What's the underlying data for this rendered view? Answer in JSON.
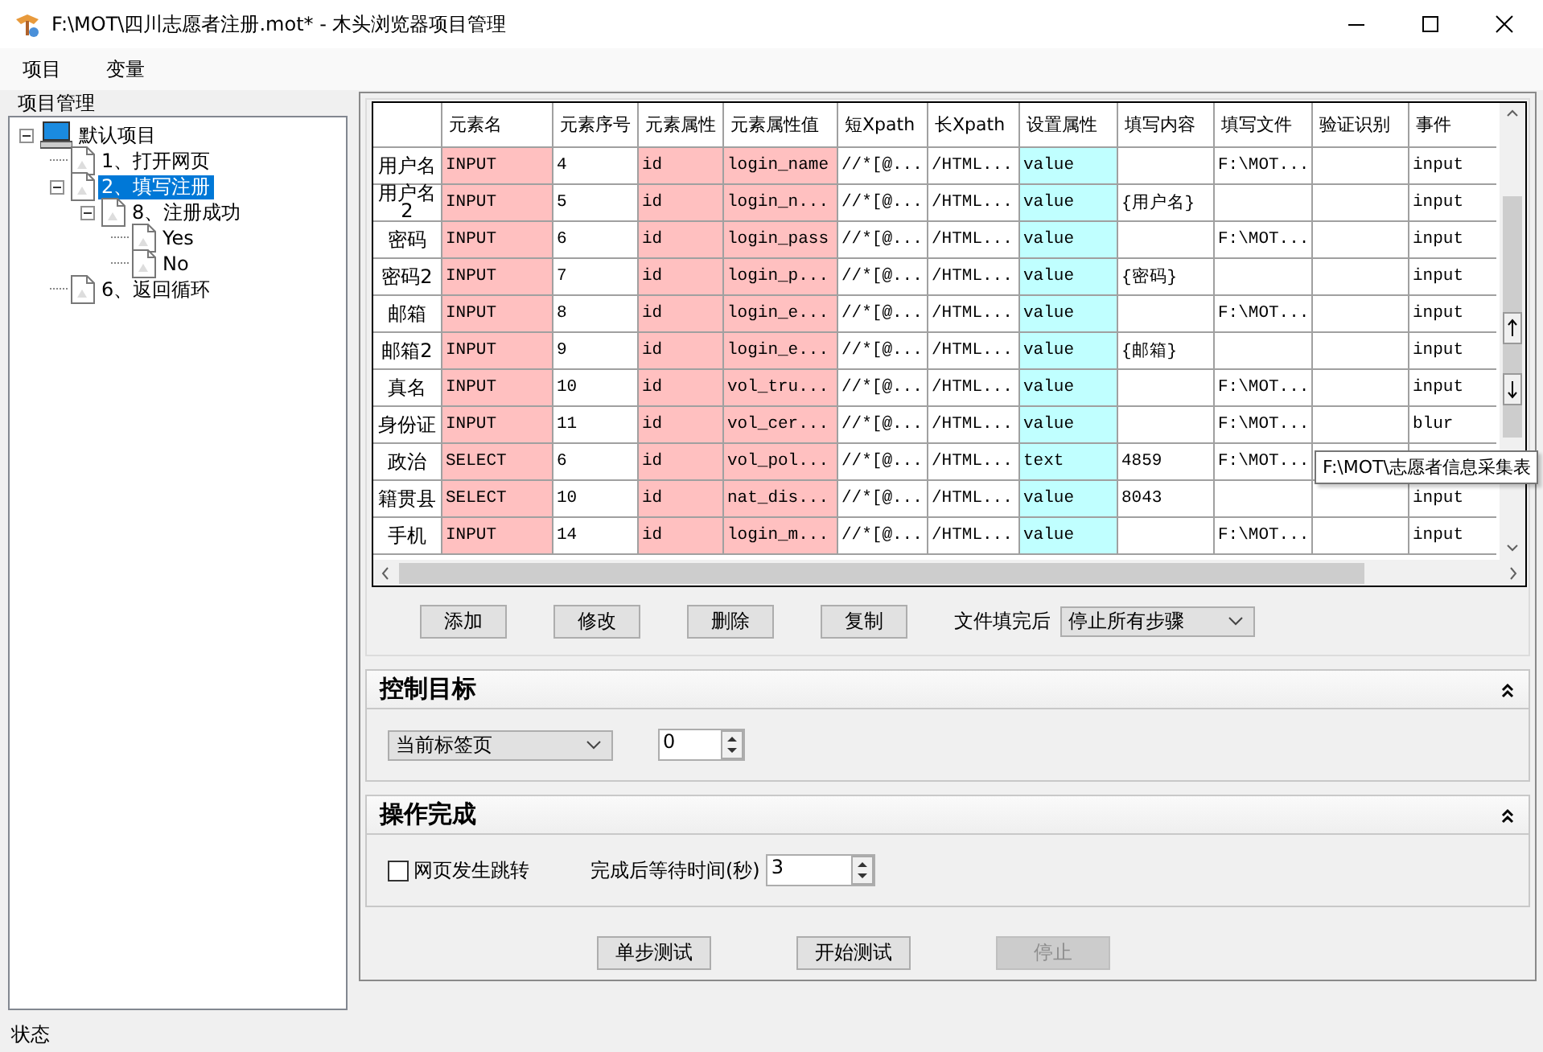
{
  "window": {
    "title": "F:\\MOT\\四川志愿者注册.mot* - 木头浏览器项目管理"
  },
  "menu": [
    "项目",
    "变量"
  ],
  "project_panel": {
    "title": "项目管理",
    "tree": [
      {
        "label": "默认项目",
        "kind": "computer",
        "selected": false,
        "expanded": true,
        "children": [
          {
            "label": "1、打开网页",
            "kind": "page",
            "selected": false
          },
          {
            "label": "2、填写注册",
            "kind": "page",
            "selected": true,
            "expanded": true,
            "children": [
              {
                "label": "8、注册成功",
                "kind": "page",
                "selected": false,
                "expanded": true,
                "children": [
                  {
                    "label": "Yes",
                    "kind": "page",
                    "selected": false
                  },
                  {
                    "label": "No",
                    "kind": "page",
                    "selected": false
                  }
                ]
              }
            ]
          },
          {
            "label": "6、返回循环",
            "kind": "page",
            "selected": false
          }
        ]
      }
    ]
  },
  "table": {
    "columns": [
      {
        "label": "元素名",
        "color": "#ffc0c0"
      },
      {
        "label": "元素序号"
      },
      {
        "label": "元素属性",
        "color": "#ffc0c0"
      },
      {
        "label": "元素属性值",
        "color": "#ffc0c0"
      },
      {
        "label": "短Xpath"
      },
      {
        "label": "长Xpath"
      },
      {
        "label": "设置属性",
        "color": "#c0ffff"
      },
      {
        "label": "填写内容"
      },
      {
        "label": "填写文件"
      },
      {
        "label": "验证识别"
      },
      {
        "label": "事件"
      }
    ],
    "rows": [
      {
        "name": "用户名",
        "cells": [
          "INPUT",
          "4",
          "id",
          "login_name",
          "//*[@...",
          "/HTML...",
          "value",
          null,
          "F:\\MOT...",
          null,
          "input"
        ]
      },
      {
        "name": "用户名2",
        "cells": [
          "INPUT",
          "5",
          "id",
          "login_n...",
          "//*[@...",
          "/HTML...",
          "value",
          "{用户名}",
          null,
          null,
          "input"
        ]
      },
      {
        "name": "密码",
        "cells": [
          "INPUT",
          "6",
          "id",
          "login_pass",
          "//*[@...",
          "/HTML...",
          "value",
          null,
          "F:\\MOT...",
          null,
          "input"
        ]
      },
      {
        "name": "密码2",
        "cells": [
          "INPUT",
          "7",
          "id",
          "login_p...",
          "//*[@...",
          "/HTML...",
          "value",
          "{密码}",
          null,
          null,
          "input"
        ]
      },
      {
        "name": "邮箱",
        "cells": [
          "INPUT",
          "8",
          "id",
          "login_e...",
          "//*[@...",
          "/HTML...",
          "value",
          null,
          "F:\\MOT...",
          null,
          "input"
        ]
      },
      {
        "name": "邮箱2",
        "cells": [
          "INPUT",
          "9",
          "id",
          "login_e...",
          "//*[@...",
          "/HTML...",
          "value",
          "{邮箱}",
          null,
          null,
          "input"
        ]
      },
      {
        "name": "真名",
        "cells": [
          "INPUT",
          "10",
          "id",
          "vol_tru...",
          "//*[@...",
          "/HTML...",
          "value",
          null,
          "F:\\MOT...",
          null,
          "input"
        ]
      },
      {
        "name": "身份证",
        "cells": [
          "INPUT",
          "11",
          "id",
          "vol_cer...",
          "//*[@...",
          "/HTML...",
          "value",
          null,
          "F:\\MOT...",
          null,
          "blur"
        ]
      },
      {
        "name": "政治",
        "cells": [
          "SELECT",
          "6",
          "id",
          "vol_pol...",
          "//*[@...",
          "/HTML...",
          "text",
          "4859",
          "F:\\MOT...",
          null,
          null
        ]
      },
      {
        "name": "籍贯县",
        "cells": [
          "SELECT",
          "10",
          "id",
          "nat_dis...",
          "//*[@...",
          "/HTML...",
          "value",
          "8043",
          null,
          null,
          "input"
        ]
      },
      {
        "name": "手机",
        "cells": [
          "INPUT",
          "14",
          "id",
          "login_m...",
          "//*[@...",
          "/HTML...",
          "value",
          null,
          "F:\\MOT...",
          null,
          "input"
        ]
      }
    ],
    "tooltip": "F:\\MOT\\志愿者信息采集表"
  },
  "row_actions": [
    "添加",
    "修改",
    "删除",
    "复制"
  ],
  "after_fill": {
    "label": "文件填完后",
    "value": "停止所有步骤"
  },
  "control_target": {
    "title": "控制目标",
    "expanded": true,
    "target": "当前标签页",
    "index": "0"
  },
  "completion": {
    "title": "操作完成",
    "expanded": true,
    "page_jump": {
      "label": "网页发生跳转",
      "checked": false
    },
    "wait": {
      "label": "完成后等待时间(秒)",
      "value": "3"
    }
  },
  "test_buttons": [
    {
      "label": "单步测试",
      "disabled": false
    },
    {
      "label": "开始测试",
      "disabled": false
    },
    {
      "label": "停止",
      "disabled": true
    }
  ],
  "status_bar": "状态"
}
